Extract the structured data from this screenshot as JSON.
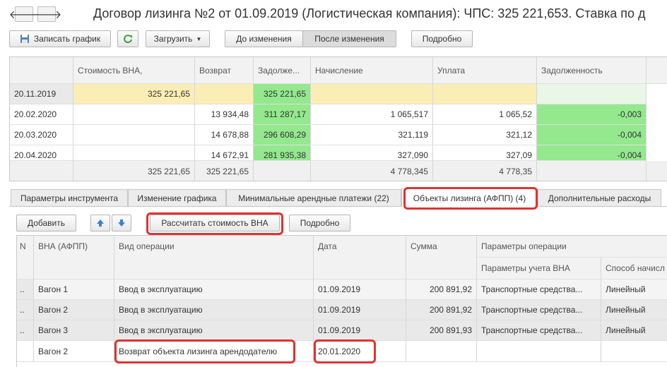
{
  "window": {
    "title": "Договор лизинга №2 от 01.09.2019 (Логистическая компания): ЧПС: 325 221,653. Ставка по д"
  },
  "nav": {
    "back_icon": "arrow-left-icon",
    "forward_icon": "arrow-right-icon"
  },
  "toolbar": {
    "save_label": "Записать график",
    "refresh_icon": "refresh-icon",
    "load_label": "Загрузить",
    "before_label": "До изменения",
    "after_label": "После изменения",
    "detail_label": "Подробно"
  },
  "schedule": {
    "headers": [
      "",
      "Стоимость ВНА,",
      "Возврат",
      "Задолже...",
      "Начисление",
      "Уплата",
      "Задолженность"
    ],
    "rows": [
      [
        "20.11.2019",
        "325 221,65",
        "",
        "325 221,65",
        "",
        "",
        ""
      ],
      [
        "20.02.2020",
        "",
        "13 934,48",
        "311 287,17",
        "1 065,517",
        "1 065,52",
        "-0,003"
      ],
      [
        "20.03.2020",
        "",
        "14 678,88",
        "296 608,29",
        "321,119",
        "321,12",
        "-0,004"
      ],
      [
        "20.04.2020",
        "",
        "14 672,91",
        "281 935,38",
        "327,090",
        "327,09",
        "-0,004"
      ]
    ],
    "footer": [
      "",
      "325 221,65",
      "325 221,65",
      "",
      "4 778,345",
      "4 778,35",
      ""
    ]
  },
  "tabs": [
    "Параметры инструмента",
    "Изменение графика",
    "Минимальные арендные платежи (22)",
    "Объекты лизинга (АФПП) (4)",
    "Дополнительные расходы"
  ],
  "objects_toolbar": {
    "add_label": "Добавить",
    "up_icon": "arrow-up-icon",
    "down_icon": "arrow-down-icon",
    "calc_label": "Рассчитать стоимость ВНА",
    "detail_label": "Подробно"
  },
  "objects": {
    "headers": {
      "n": "N",
      "vna": "ВНА (АФПП)",
      "op": "Вид операции",
      "date": "Дата",
      "sum": "Сумма",
      "params": "Параметры операции",
      "params_acc": "Параметры учета ВНА",
      "method": "Способ начисл"
    },
    "rows": [
      {
        "n": "..",
        "vna": "Вагон 1",
        "op": "Ввод в эксплуатацию",
        "date": "01.09.2019",
        "sum": "200 891,92",
        "params": "Транспортные средства...",
        "method": "Линейный"
      },
      {
        "n": "..",
        "vna": "Вагон 2",
        "op": "Ввод в эксплуатацию",
        "date": "01.09.2019",
        "sum": "200 891,92",
        "params": "Транспортные средства...",
        "method": "Линейный"
      },
      {
        "n": "..",
        "vna": "Вагон 3",
        "op": "Ввод в эксплуатацию",
        "date": "01.09.2019",
        "sum": "200 891,93",
        "params": "Транспортные средства...",
        "method": "Линейный"
      },
      {
        "n": "",
        "vna": "Вагон 2",
        "op": "Возврат объекта лизинга арендодателю",
        "date": "20.01.2020",
        "sum": "",
        "params": "",
        "method": ""
      }
    ]
  },
  "colors": {
    "highlight": "#e03232",
    "green": "#94e88e",
    "yellow": "#fbeeb5"
  }
}
